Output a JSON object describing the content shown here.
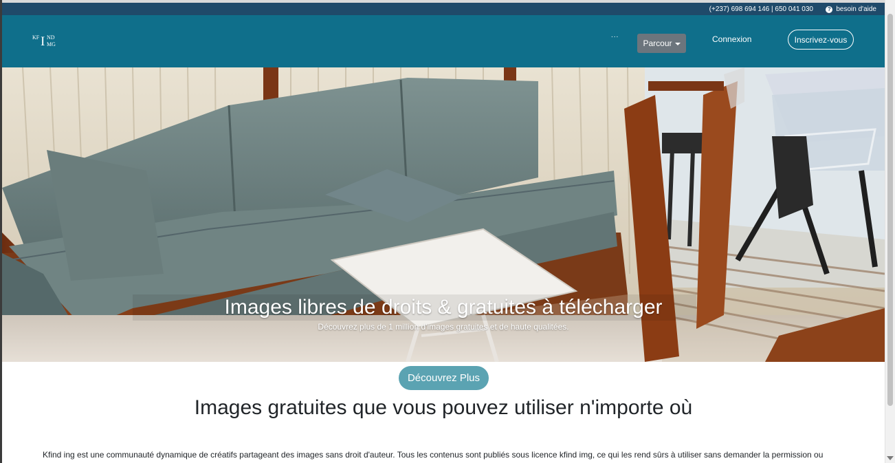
{
  "topbar": {
    "phone": "(+237) 698 694 146 | 650 041 030",
    "help_label": "besoin d'aide",
    "help_icon": "question-circle-icon"
  },
  "navbar": {
    "logo": {
      "kf": "KF",
      "i": "I",
      "nd": "ND",
      "mg": "MG"
    },
    "dots": "...",
    "parcour_label": "Parcour",
    "login_label": "Connexion",
    "signup_label": "Inscrivez-vous",
    "colors": {
      "bar": "#0f6f8b",
      "topbar": "#1f4a6a",
      "dropdown_button": "#6c757d"
    }
  },
  "hero": {
    "title": "Images libres de droits & gratuites à télécharger",
    "subtitle": "Découvrez plus de 1 million d'images gratuites et de haute qualitées."
  },
  "cta": {
    "discover_label": "Découvrez Plus",
    "color": "#5ba3b2"
  },
  "section": {
    "title": "Images gratuites que vous pouvez utiliser n'importe où",
    "paragraph": "Kfind ing est une communauté dynamique de créatifs partageant des images sans droit d'auteur. Tous les contenus sont publiés sous licence kfind img, ce qui les rend sûrs à utiliser sans demander la permission ou"
  }
}
